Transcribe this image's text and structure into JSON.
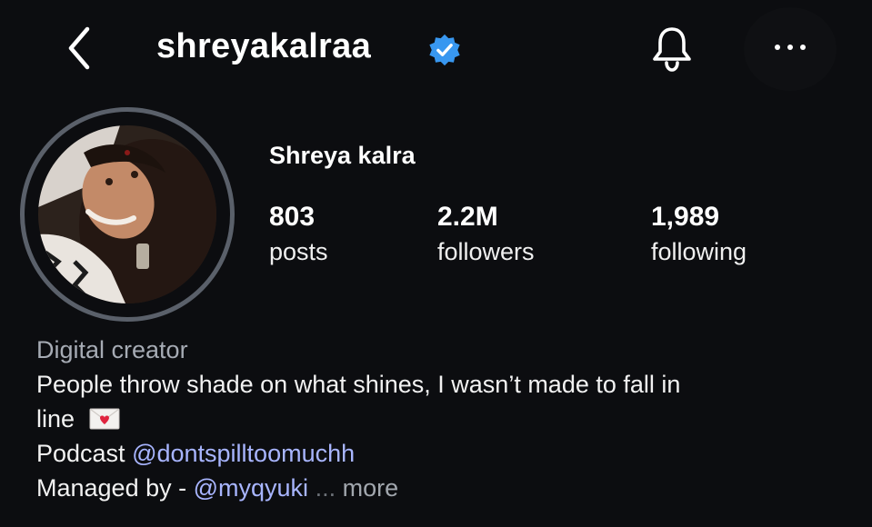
{
  "header": {
    "username": "shreyakalraa",
    "icons": {
      "back": "back-chevron-icon",
      "verified": "verified-badge-icon",
      "notifications": "bell-icon",
      "more": "more-options-icon"
    }
  },
  "profile": {
    "display_name": "Shreya kalra",
    "stats": [
      {
        "value": "803",
        "label": "posts"
      },
      {
        "value": "2.2M",
        "label": "followers"
      },
      {
        "value": "1,989",
        "label": "following"
      }
    ]
  },
  "bio": {
    "category": "Digital creator",
    "line1": "People throw shade on what shines, I wasn’t made to fall in",
    "line2": "line",
    "emoji": "love-letter-icon",
    "podcast_prefix": "Podcast",
    "podcast_handle": "@dontspilltoomuchh",
    "managed_prefix": "Managed by -",
    "managed_handle": "@myqyuki",
    "ellipsis": "...",
    "more_label": "more"
  },
  "colors": {
    "background": "#0c0d10",
    "mention": "#a8b5ff",
    "verified": "#3897f0",
    "muted": "#a6abb4"
  }
}
